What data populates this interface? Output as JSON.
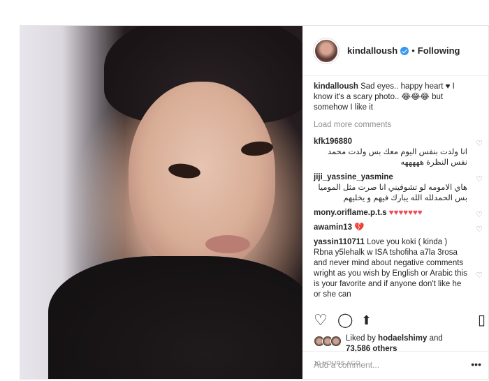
{
  "header": {
    "username": "kindalloush",
    "separator": "•",
    "follow_status": "Following"
  },
  "caption": {
    "username": "kindalloush",
    "text": "Sad eyes.. happy heart ♥ I know it's a scary photo.. 😂😂😂 but somehow I like it"
  },
  "load_more": "Load more comments",
  "comments": [
    {
      "user": "kfk196880",
      "text": "انا ولدت بنفس اليوم معك بس ولدت محمد نفس النظرة هههههه",
      "rtl": true
    },
    {
      "user": "jiji_yassine_yasmine",
      "text": "هاي الامومه لو تشوفيني انا صرت مثل الموميا بس الحمدلله الله يبارك فيهم و يخليهم",
      "rtl": true
    },
    {
      "user": "mony.oriflame.p.t.s",
      "text": "♥♥♥♥♥♥♥",
      "rtl": false
    },
    {
      "user": "awamin13",
      "text": "💔",
      "rtl": false
    },
    {
      "user": "yassin110711",
      "text": "Love you koki ( kinda ) Rbna y5lehalk w ISA tshofiha a7la 3rosa and never mind about negative comments wright as you wish by English or Arabic this is your favorite and if anyone don't like he or she can",
      "rtl": false
    }
  ],
  "likes": {
    "prefix": "Liked by",
    "first_user": "hodaelshimy",
    "connector": "and",
    "count": "73,586 others"
  },
  "timestamp": "10 HOURS AGO",
  "add_comment_placeholder": "Add a comment...",
  "icons": {
    "like": "heart-outline-icon",
    "comment": "comment-bubble-icon",
    "share": "share-arrow-icon",
    "save": "bookmark-icon",
    "more": "ellipsis-icon",
    "comment_like": "small-heart-icon"
  },
  "colors": {
    "text": "#262626",
    "muted": "#8e8e8e",
    "border": "#efefef",
    "verified": "#3897f0",
    "heart": "#ed4956"
  }
}
